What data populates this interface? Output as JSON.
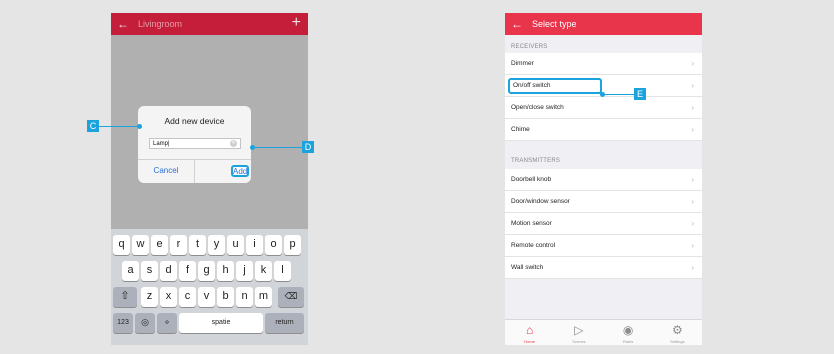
{
  "phone1": {
    "header": {
      "back_icon": "arrow-left-icon",
      "title": "Livingroom",
      "add_icon": "plus-icon"
    },
    "dialog": {
      "title": "Add new device",
      "input_value": "Lamp",
      "clear_icon": "clear-icon",
      "cancel_label": "Cancel",
      "add_label": "Add"
    },
    "keyboard": {
      "row1": [
        "q",
        "w",
        "e",
        "r",
        "t",
        "y",
        "u",
        "i",
        "o",
        "p"
      ],
      "row2": [
        "a",
        "s",
        "d",
        "f",
        "g",
        "h",
        "j",
        "k",
        "l"
      ],
      "row3": [
        "z",
        "x",
        "c",
        "v",
        "b",
        "n",
        "m"
      ],
      "shift_icon": "shift-icon",
      "backspace_icon": "backspace-icon",
      "numbers_label": "123",
      "globe_icon": "globe-icon",
      "mic_icon": "microphone-icon",
      "space_label": "spatie",
      "return_label": "return"
    }
  },
  "callouts": {
    "c": "C",
    "d": "D",
    "e": "E"
  },
  "phone2": {
    "header": {
      "back_icon": "arrow-left-icon",
      "title": "Select type"
    },
    "receivers_heading": "RECEIVERS",
    "receivers": [
      "Dimmer",
      "On/off switch",
      "Open/close switch",
      "Chime"
    ],
    "transmitters_heading": "TRANSMITTERS",
    "transmitters": [
      "Doorbell knob",
      "Door/window sensor",
      "Motion sensor",
      "Remote control",
      "Wall switch"
    ],
    "tabs": [
      {
        "label": "Home",
        "icon": "home-icon",
        "active": true
      },
      {
        "label": "Scenes",
        "icon": "play-icon",
        "active": false
      },
      {
        "label": "Rules",
        "icon": "rules-icon",
        "active": false
      },
      {
        "label": "Settings",
        "icon": "gear-icon",
        "active": false
      }
    ],
    "colors": {
      "header": "#e8354b",
      "accent": "#1aa3dc"
    }
  }
}
